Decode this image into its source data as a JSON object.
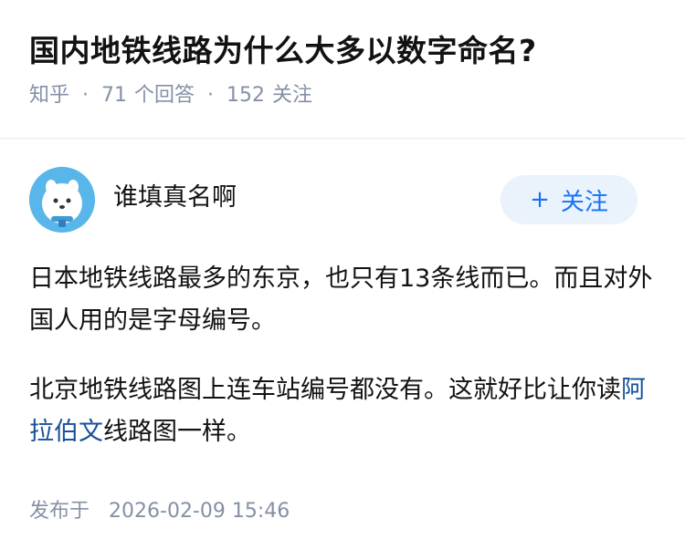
{
  "question": {
    "title": "国内地铁线路为什么大多以数字命名?",
    "source": "知乎",
    "separator": "·",
    "answers_count": "71",
    "answers_label": "个回答",
    "followers_count": "152",
    "followers_label": "关注"
  },
  "answer": {
    "author_name": "谁填真名啊",
    "follow_plus": "+",
    "follow_label": "关注",
    "paragraph1": "日本地铁线路最多的东京，也只有13条线而已。而且对外国人用的是字母编号。",
    "paragraph2_before": "北京地铁线路图上连车站编号都没有。这就好比让你读",
    "paragraph2_link": "阿拉伯文",
    "paragraph2_after": "线路图一样。",
    "published_label": "发布于",
    "published_time": "2026-02-09 15:46"
  },
  "colors": {
    "link": "#175199",
    "accent": "#1772f6",
    "meta": "#8590a6",
    "avatar_bg": "#58b6ea"
  },
  "icons": {
    "avatar": "cartoon-animal-avatar"
  }
}
